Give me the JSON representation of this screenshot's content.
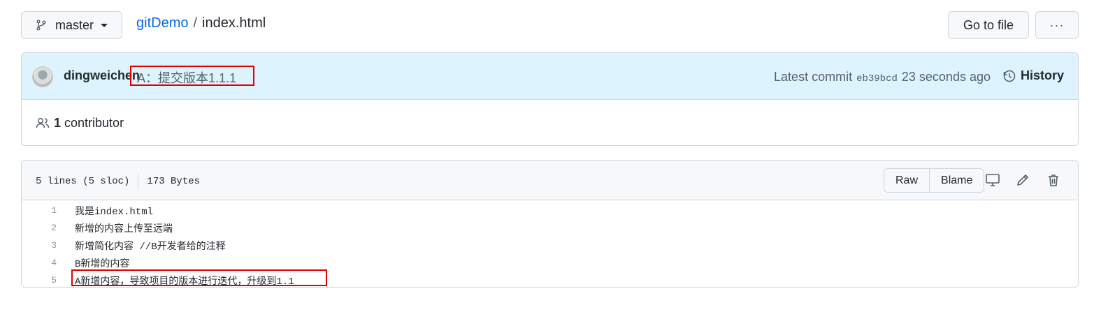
{
  "branch": {
    "name": "master"
  },
  "breadcrumb": {
    "repo": "gitDemo",
    "separator": "/",
    "file": "index.html"
  },
  "actions": {
    "goto_file": "Go to file",
    "more": "···"
  },
  "commit": {
    "author": "dingweichen",
    "message": "A：提交版本1.1.1",
    "latest_label": "Latest commit",
    "sha": "eb39bcd",
    "time": "23 seconds ago",
    "history_label": "History"
  },
  "contributors": {
    "count": "1",
    "label": "contributor"
  },
  "file": {
    "lines_info": "5 lines (5 sloc)",
    "size": "173 Bytes",
    "raw_label": "Raw",
    "blame_label": "Blame",
    "lines": [
      {
        "num": "1",
        "text": "我是index.html"
      },
      {
        "num": "2",
        "text": "新增的内容上传至远端"
      },
      {
        "num": "3",
        "text": "新增简化内容 //B开发者给的注释"
      },
      {
        "num": "4",
        "text": "B新增的内容"
      },
      {
        "num": "5",
        "text": "A新增内容，导致项目的版本进行迭代，升级到1.1"
      }
    ]
  },
  "colors": {
    "link": "#0969da",
    "highlight": "#e00000",
    "commit_bg": "#ddf4ff"
  }
}
